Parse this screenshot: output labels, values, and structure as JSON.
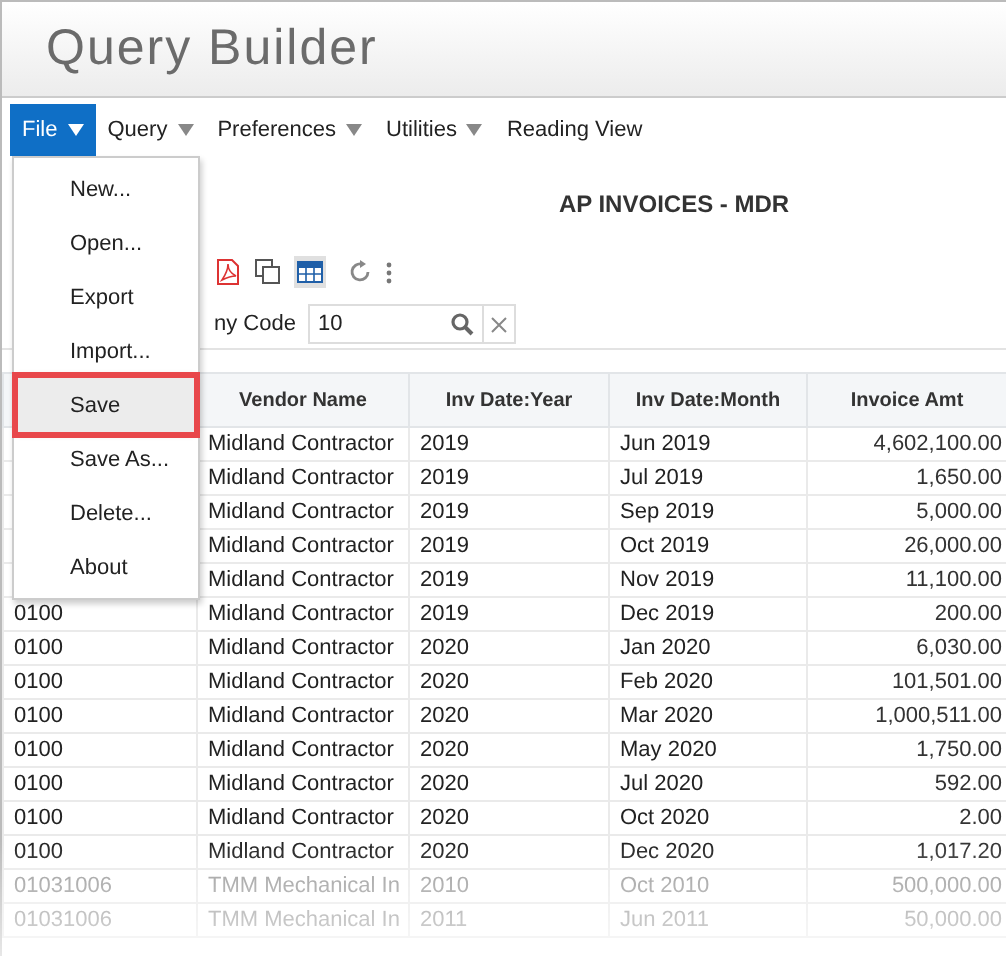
{
  "app_title": "Query Builder",
  "menubar": [
    {
      "label": "File",
      "kind": "dropdown",
      "selected": true
    },
    {
      "label": "Query",
      "kind": "dropdown",
      "selected": false
    },
    {
      "label": "Preferences",
      "kind": "dropdown",
      "selected": false
    },
    {
      "label": "Utilities",
      "kind": "dropdown",
      "selected": false
    },
    {
      "label": "Reading View",
      "kind": "plain",
      "selected": false
    }
  ],
  "file_menu": [
    {
      "label": "New...",
      "selected": false
    },
    {
      "label": "Open...",
      "selected": false
    },
    {
      "label": "Export",
      "selected": false
    },
    {
      "label": "Import...",
      "selected": false
    },
    {
      "label": "Save",
      "selected": true
    },
    {
      "label": "Save As...",
      "selected": false
    },
    {
      "label": "Delete...",
      "selected": false
    },
    {
      "label": "About",
      "selected": false
    }
  ],
  "report_title": "AP INVOICES - MDR",
  "filter": {
    "label": "ny Code",
    "value": "10"
  },
  "table": {
    "columns": [
      "Vendor Name",
      "Inv Date:Year",
      "Inv Date:Month",
      "Invoice Amt"
    ],
    "rows": [
      {
        "vendor": "Midland Contractor",
        "year": "2019",
        "month": "Jun 2019",
        "amount": "4,602,100.00"
      },
      {
        "vendor": "Midland Contractor",
        "year": "2019",
        "month": "Jul 2019",
        "amount": "1,650.00"
      },
      {
        "vendor": "Midland Contractor",
        "year": "2019",
        "month": "Sep 2019",
        "amount": "5,000.00"
      },
      {
        "vendor": "Midland Contractor",
        "year": "2019",
        "month": "Oct 2019",
        "amount": "26,000.00"
      },
      {
        "vendor": "Midland Contractor",
        "year": "2019",
        "month": "Nov 2019",
        "amount": "11,100.00"
      },
      {
        "code": "0100",
        "vendor": "Midland Contractor",
        "year": "2019",
        "month": "Dec 2019",
        "amount": "200.00"
      },
      {
        "code": "0100",
        "vendor": "Midland Contractor",
        "year": "2020",
        "month": "Jan 2020",
        "amount": "6,030.00"
      },
      {
        "code": "0100",
        "vendor": "Midland Contractor",
        "year": "2020",
        "month": "Feb 2020",
        "amount": "101,501.00"
      },
      {
        "code": "0100",
        "vendor": "Midland Contractor",
        "year": "2020",
        "month": "Mar 2020",
        "amount": "1,000,511.00"
      },
      {
        "code": "0100",
        "vendor": "Midland Contractor",
        "year": "2020",
        "month": "May 2020",
        "amount": "1,750.00"
      },
      {
        "code": "0100",
        "vendor": "Midland Contractor",
        "year": "2020",
        "month": "Jul 2020",
        "amount": "592.00"
      },
      {
        "code": "0100",
        "vendor": "Midland Contractor",
        "year": "2020",
        "month": "Oct 2020",
        "amount": "2.00"
      },
      {
        "code": "0100",
        "vendor": "Midland Contractor",
        "year": "2020",
        "month": "Dec 2020",
        "amount": "1,017.20"
      },
      {
        "code": "01031006",
        "vendor": "TMM Mechanical In",
        "year": "2010",
        "month": "Oct 2010",
        "amount": "500,000.00"
      },
      {
        "code": "01031006",
        "vendor": "TMM Mechanical In",
        "year": "2011",
        "month": "Jun 2011",
        "amount": "50,000.00"
      }
    ]
  }
}
